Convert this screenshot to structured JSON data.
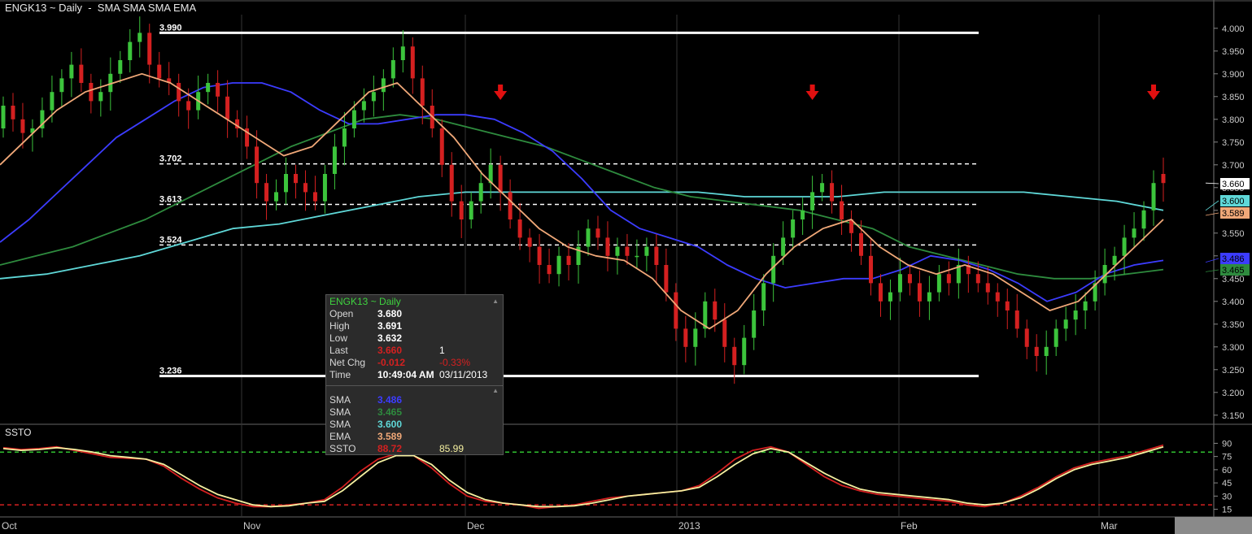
{
  "header": {
    "title": "ENGK13 ~ Daily  -  SMA SMA SMA EMA"
  },
  "lower_panel": {
    "title": "SSTO"
  },
  "info_box": {
    "title": "ENGK13 ~ Daily",
    "rows": [
      {
        "label": "Open",
        "v1": "3.680",
        "v2": ""
      },
      {
        "label": "High",
        "v1": "3.691",
        "v2": ""
      },
      {
        "label": "Low",
        "v1": "3.632",
        "v2": ""
      },
      {
        "label": "Last",
        "v1": "3.660",
        "v2": "1"
      },
      {
        "label": "Net Chg",
        "v1": "-0.012",
        "v2": "-0.33%"
      },
      {
        "label": "Time",
        "v1": "10:49:04 AM",
        "v2": "03/11/2013"
      }
    ],
    "ind_rows": [
      {
        "label": "SMA",
        "v1": "3.486",
        "v2": ""
      },
      {
        "label": "SMA",
        "v1": "3.465",
        "v2": ""
      },
      {
        "label": "SMA",
        "v1": "3.600",
        "v2": ""
      },
      {
        "label": "EMA",
        "v1": "3.589",
        "v2": ""
      },
      {
        "label": "SSTO",
        "v1": "88.72",
        "v2": "85.99"
      }
    ]
  },
  "colors": {
    "up": "#3cc43c",
    "down": "#d42020",
    "sma_blue": "#3c3cff",
    "sma_green": "#2e8b3e",
    "sma_cyan": "#5fd8d8",
    "ema": "#f0a878",
    "ssto_k": "#d42020",
    "ssto_d": "#f5f0a0"
  },
  "chart_data": [
    {
      "type": "candlestick",
      "title": "ENGK13 ~ Daily  -  SMA SMA SMA EMA",
      "x_ticks": [
        "Oct",
        "Nov",
        "Dec",
        "2013",
        "Feb",
        "Mar"
      ],
      "y_ticks": [
        "3.150",
        "3.200",
        "3.250",
        "3.300",
        "3.350",
        "3.400",
        "3.450",
        "3.500",
        "3.550",
        "3.600",
        "3.650",
        "3.700",
        "3.750",
        "3.800",
        "3.850",
        "3.900",
        "3.950",
        "4.000"
      ],
      "ylim": [
        3.13,
        4.03
      ],
      "horizontal_levels": [
        {
          "label": "3.990",
          "value": 3.99,
          "style": "solid"
        },
        {
          "label": "3.702",
          "value": 3.702,
          "style": "dashed"
        },
        {
          "label": "3.613",
          "value": 3.613,
          "style": "dashed"
        },
        {
          "label": "3.524",
          "value": 3.524,
          "style": "dashed"
        },
        {
          "label": "3.236",
          "value": 3.236,
          "style": "solid"
        }
      ],
      "arrow_markers_at_day": [
        51,
        83,
        118
      ],
      "last_value_badges": [
        {
          "label": "3.660",
          "value": 3.66,
          "color": "#ffffff"
        },
        {
          "label": "3.600",
          "value": 3.6,
          "color": "#5fd8d8"
        },
        {
          "label": "3.589",
          "value": 3.589,
          "color": "#f0a878"
        },
        {
          "label": "3.486",
          "value": 3.486,
          "color": "#3c3cff"
        },
        {
          "label": "3.465",
          "value": 3.465,
          "color": "#2e8b3e"
        }
      ],
      "candles_close": [
        3.83,
        3.8,
        3.77,
        3.78,
        3.82,
        3.86,
        3.89,
        3.92,
        3.88,
        3.84,
        3.86,
        3.9,
        3.93,
        3.97,
        3.99,
        3.92,
        3.89,
        3.88,
        3.84,
        3.82,
        3.86,
        3.88,
        3.85,
        3.8,
        3.78,
        3.74,
        3.66,
        3.62,
        3.64,
        3.68,
        3.66,
        3.64,
        3.62,
        3.68,
        3.74,
        3.78,
        3.82,
        3.84,
        3.86,
        3.89,
        3.93,
        3.96,
        3.89,
        3.83,
        3.78,
        3.7,
        3.62,
        3.58,
        3.62,
        3.66,
        3.7,
        3.64,
        3.58,
        3.54,
        3.52,
        3.48,
        3.46,
        3.5,
        3.48,
        3.52,
        3.56,
        3.54,
        3.5,
        3.52,
        3.5,
        3.5,
        3.52,
        3.48,
        3.42,
        3.34,
        3.3,
        3.34,
        3.4,
        3.36,
        3.3,
        3.26,
        3.32,
        3.38,
        3.44,
        3.5,
        3.54,
        3.58,
        3.6,
        3.64,
        3.66,
        3.62,
        3.58,
        3.55,
        3.5,
        3.44,
        3.4,
        3.42,
        3.46,
        3.44,
        3.4,
        3.42,
        3.46,
        3.44,
        3.48,
        3.46,
        3.44,
        3.42,
        3.4,
        3.38,
        3.34,
        3.3,
        3.28,
        3.3,
        3.34,
        3.36,
        3.38,
        3.4,
        3.44,
        3.48,
        3.5,
        3.54,
        3.56,
        3.6,
        3.66,
        3.66
      ],
      "candles_open": [
        3.78,
        3.83,
        3.8,
        3.77,
        3.78,
        3.82,
        3.86,
        3.89,
        3.92,
        3.88,
        3.84,
        3.86,
        3.9,
        3.93,
        3.97,
        3.99,
        3.92,
        3.89,
        3.88,
        3.84,
        3.82,
        3.86,
        3.88,
        3.85,
        3.8,
        3.78,
        3.74,
        3.66,
        3.62,
        3.64,
        3.68,
        3.66,
        3.64,
        3.62,
        3.68,
        3.74,
        3.78,
        3.82,
        3.84,
        3.86,
        3.89,
        3.93,
        3.96,
        3.89,
        3.83,
        3.78,
        3.7,
        3.62,
        3.58,
        3.62,
        3.66,
        3.7,
        3.64,
        3.58,
        3.54,
        3.52,
        3.48,
        3.46,
        3.5,
        3.48,
        3.52,
        3.56,
        3.54,
        3.5,
        3.52,
        3.5,
        3.5,
        3.52,
        3.48,
        3.42,
        3.34,
        3.3,
        3.34,
        3.4,
        3.36,
        3.3,
        3.26,
        3.32,
        3.38,
        3.44,
        3.5,
        3.54,
        3.58,
        3.6,
        3.64,
        3.66,
        3.62,
        3.58,
        3.55,
        3.5,
        3.44,
        3.4,
        3.42,
        3.46,
        3.44,
        3.4,
        3.42,
        3.46,
        3.44,
        3.48,
        3.46,
        3.44,
        3.42,
        3.4,
        3.38,
        3.34,
        3.3,
        3.28,
        3.3,
        3.34,
        3.36,
        3.38,
        3.4,
        3.44,
        3.48,
        3.5,
        3.54,
        3.56,
        3.6,
        3.68
      ],
      "sma_blue": [
        3.53,
        3.58,
        3.64,
        3.7,
        3.76,
        3.8,
        3.84,
        3.87,
        3.88,
        3.88,
        3.86,
        3.82,
        3.79,
        3.79,
        3.8,
        3.81,
        3.81,
        3.8,
        3.77,
        3.73,
        3.67,
        3.6,
        3.56,
        3.54,
        3.52,
        3.48,
        3.45,
        3.43,
        3.44,
        3.45,
        3.45,
        3.47,
        3.5,
        3.49,
        3.47,
        3.44,
        3.4,
        3.42,
        3.46,
        3.48,
        3.49
      ],
      "sma_green": [
        3.48,
        3.5,
        3.52,
        3.55,
        3.58,
        3.62,
        3.66,
        3.7,
        3.74,
        3.77,
        3.8,
        3.81,
        3.8,
        3.78,
        3.76,
        3.74,
        3.71,
        3.68,
        3.65,
        3.63,
        3.62,
        3.61,
        3.6,
        3.58,
        3.56,
        3.52,
        3.5,
        3.48,
        3.46,
        3.45,
        3.45,
        3.46,
        3.47
      ],
      "sma_cyan": [
        3.45,
        3.46,
        3.48,
        3.5,
        3.53,
        3.56,
        3.57,
        3.59,
        3.61,
        3.63,
        3.64,
        3.64,
        3.64,
        3.64,
        3.64,
        3.64,
        3.63,
        3.63,
        3.63,
        3.64,
        3.64,
        3.64,
        3.64,
        3.63,
        3.62,
        3.6
      ],
      "ema": [
        3.7,
        3.76,
        3.82,
        3.86,
        3.88,
        3.9,
        3.88,
        3.84,
        3.8,
        3.76,
        3.72,
        3.74,
        3.8,
        3.86,
        3.88,
        3.82,
        3.76,
        3.68,
        3.62,
        3.56,
        3.52,
        3.5,
        3.49,
        3.45,
        3.38,
        3.34,
        3.38,
        3.46,
        3.52,
        3.56,
        3.58,
        3.52,
        3.48,
        3.46,
        3.48,
        3.46,
        3.42,
        3.38,
        3.4,
        3.46,
        3.52,
        3.58
      ],
      "ylabel": ""
    },
    {
      "type": "line",
      "title": "SSTO",
      "y_ticks": [
        "15",
        "30",
        "45",
        "60",
        "75",
        "90"
      ],
      "ylim": [
        10,
        95
      ],
      "levels": [
        {
          "value": 80,
          "color": "#30c030"
        },
        {
          "value": 20,
          "color": "#d42020"
        }
      ],
      "series": [
        {
          "name": "",
          "color": "#d42020",
          "values": [
            85,
            83,
            84,
            86,
            82,
            78,
            74,
            73,
            72,
            64,
            50,
            38,
            28,
            22,
            18,
            18,
            20,
            22,
            26,
            40,
            58,
            72,
            78,
            76,
            62,
            44,
            30,
            24,
            22,
            20,
            16,
            18,
            20,
            24,
            28,
            30,
            32,
            34,
            36,
            42,
            56,
            72,
            82,
            86,
            80,
            66,
            52,
            42,
            36,
            32,
            30,
            28,
            26,
            24,
            20,
            18,
            22,
            30,
            40,
            52,
            62,
            68,
            72,
            76,
            82,
            88
          ]
        },
        {
          "name": "",
          "color": "#f5f0a0",
          "values": [
            84,
            82,
            83,
            85,
            83,
            80,
            76,
            74,
            72,
            66,
            54,
            42,
            32,
            26,
            20,
            18,
            19,
            22,
            24,
            36,
            52,
            68,
            76,
            76,
            66,
            48,
            34,
            26,
            22,
            20,
            18,
            18,
            19,
            22,
            26,
            30,
            32,
            34,
            36,
            40,
            52,
            66,
            78,
            84,
            80,
            68,
            56,
            46,
            38,
            34,
            32,
            30,
            28,
            26,
            22,
            20,
            22,
            28,
            38,
            50,
            60,
            66,
            70,
            74,
            80,
            86
          ]
        }
      ],
      "xlabel": "",
      "ylabel": ""
    }
  ]
}
